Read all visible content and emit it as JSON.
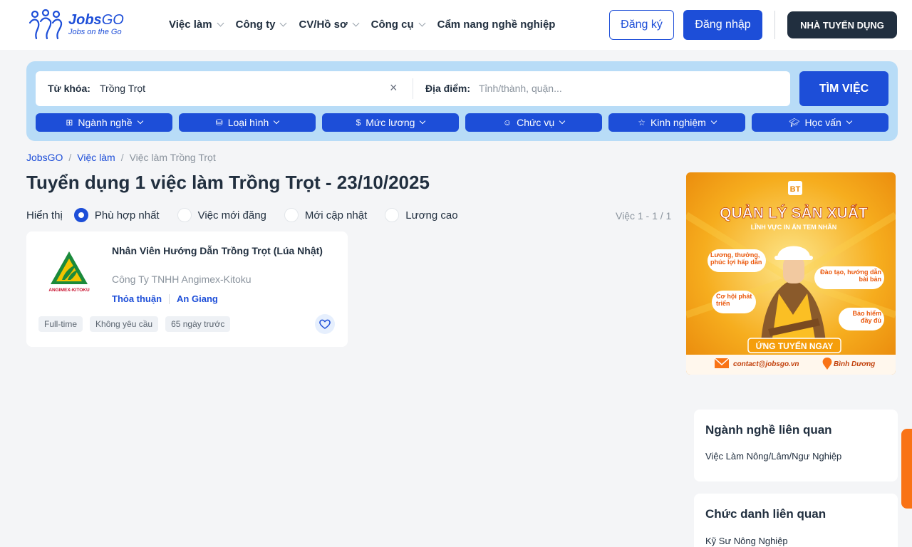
{
  "header": {
    "logo_title_a": "Jobs",
    "logo_title_b": "GO",
    "logo_tagline": "Jobs on the Go",
    "nav": [
      {
        "label": "Việc làm",
        "has_dropdown": true
      },
      {
        "label": "Công ty",
        "has_dropdown": true
      },
      {
        "label": "CV/Hồ sơ",
        "has_dropdown": true
      },
      {
        "label": "Công cụ",
        "has_dropdown": true
      },
      {
        "label": "Cẩm nang nghề nghiệp",
        "has_dropdown": false
      }
    ],
    "register_label": "Đăng ký",
    "login_label": "Đăng nhập",
    "employer_label": "NHÀ TUYỂN DỤNG"
  },
  "search": {
    "keyword_label": "Từ khóa:",
    "keyword_value": "Trồng Trọt",
    "location_label": "Địa điểm:",
    "location_placeholder": "Tỉnh/thành, quận...",
    "button_label": "TÌM VIỆC",
    "filters": [
      {
        "label": "Ngành nghề",
        "icon": "grid-icon"
      },
      {
        "label": "Loại hình",
        "icon": "briefcase-icon"
      },
      {
        "label": "Mức lương",
        "icon": "dollar-icon"
      },
      {
        "label": "Chức vụ",
        "icon": "user-icon"
      },
      {
        "label": "Kinh nghiệm",
        "icon": "star-icon"
      },
      {
        "label": "Học vấn",
        "icon": "graduation-cap-icon"
      }
    ]
  },
  "breadcrumb": [
    "JobsGO",
    "Việc làm",
    "Việc làm Trồng Trọt"
  ],
  "page_title": "Tuyển dụng 1 việc làm Trồng Trọt - 23/10/2025",
  "sort": {
    "label": "Hiển thị",
    "options": [
      "Phù hợp nhất",
      "Việc mới đăng",
      "Mới cập nhật",
      "Lương cao"
    ],
    "selected": "Phù hợp nhất",
    "count_text": "Việc 1 - 1 / 1"
  },
  "jobs": [
    {
      "title": "Nhân Viên Hướng Dẫn Trồng Trọt (Lúa Nhật)",
      "company": "Công Ty TNHH Angimex-Kitoku",
      "logo_text": "ANGIMEX-KITOKU",
      "salary": "Thỏa thuận",
      "location": "An Giang",
      "tags": [
        "Full-time",
        "Không yêu cầu",
        "65 ngày trước"
      ]
    }
  ],
  "banner": {
    "title": "QUẢN LÝ SẢN XUẤT",
    "subtitle": "LĨNH VỰC IN ẤN TEM NHÃN",
    "benefits": [
      "Lương, thưởng, phúc lợi hấp dẫn",
      "Đào tạo, hướng dẫn bài bản",
      "Cơ hội phát triển",
      "Bảo hiểm đầy đủ"
    ],
    "cta": "ỨNG TUYỂN NGAY",
    "email": "contact@jobsgo.vn",
    "location": "Bình Dương"
  },
  "related": [
    {
      "title": "Ngành nghề liên quan",
      "items": [
        "Việc Làm Nông/Lâm/Ngư Nghiệp"
      ]
    },
    {
      "title": "Chức danh liên quan",
      "items": [
        "Kỹ Sư Nông Nghiệp"
      ]
    }
  ],
  "colors": {
    "primary": "#1d4ed8",
    "dark": "#212f3f",
    "search_bg": "#b8dcf7",
    "banner": "#f59e0b"
  }
}
